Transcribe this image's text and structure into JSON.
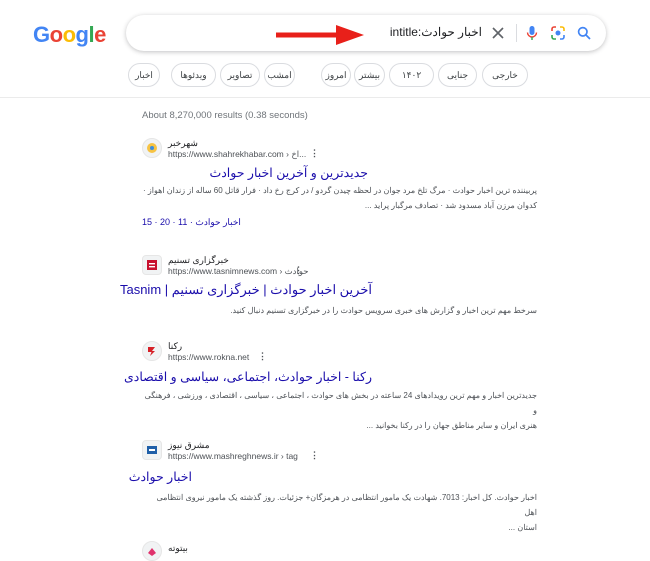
{
  "logo": {
    "letters": [
      "G",
      "o",
      "o",
      "g",
      "l",
      "e"
    ],
    "colors": [
      "#4285F4",
      "#EA4335",
      "#FBBC05",
      "#4285F4",
      "#34A853",
      "#EA4335"
    ]
  },
  "search": {
    "query": "intitle:اخبار حوادث"
  },
  "filters": [
    "خارجی",
    "جنایی",
    "۱۴۰۲",
    "بیشتر",
    "امروز",
    "امشب",
    "تصاویر",
    "ویدئوها",
    "اخبار"
  ],
  "stats": "About 8,270,000 results (0.38 seconds)",
  "results": [
    {
      "site": "شهرخبر",
      "url": "https://www.shahrekhabar.com › اخ...",
      "title": "جدیدترین و آخرین اخبار حوادث",
      "snippet_line1": "پربیننده ترین اخبار حوادث · مرگ تلخ مرد جوان در لحظه چیدن گردو / در کرج رخ داد · فرار قاتل 60 ساله از زندان اهواز ·",
      "snippet_line2": "کدوان مرزن آباد مسدود شد · تصادف مرگبار پراید ...",
      "links": "اخبار حوادث · 11 · 20 · 15"
    },
    {
      "site": "خبرگزاری تسنیم",
      "url": "https://www.tasnimnews.com › حوادث",
      "title": "آخرین اخبار حوادث | خبرگزاری تسنیم | Tasnim",
      "snippet_line1": "سرخط مهم ترین اخبار و گزارش های خبری سرویس حوادث را در خبرگزاری تسنیم دنبال کنید.",
      "snippet_line2": ""
    },
    {
      "site": "رکنا",
      "url": "https://www.rokna.net",
      "title": "رکنا - اخبار حوادث، اجتماعی، سیاسی و اقتصادی",
      "snippet_line1": "جدیدترین اخبار و مهم ترین رویدادهای 24 ساعته در بخش های حوادث ، اجتماعی ، سیاسی ، اقتصادی ، ورزشی ، فرهنگی و",
      "snippet_line2": "هنری ایران و سایر مناطق جهان را در رکنا بخوانید ..."
    },
    {
      "site": "مشرق نیوز",
      "url": "https://www.mashreghnews.ir › tag",
      "title": "اخبار حوادث",
      "snippet_line1": "اخبار حوادث. کل اخبار: 7013. شهادت یک مامور انتظامی در هرمزگان+ جزئیات. روز گذشته یک مامور نیروی انتظامی اهل",
      "snippet_line2": "استان ..."
    },
    {
      "site": "بیتوته",
      "url": "",
      "title": "",
      "snippet_line1": "",
      "snippet_line2": ""
    }
  ]
}
